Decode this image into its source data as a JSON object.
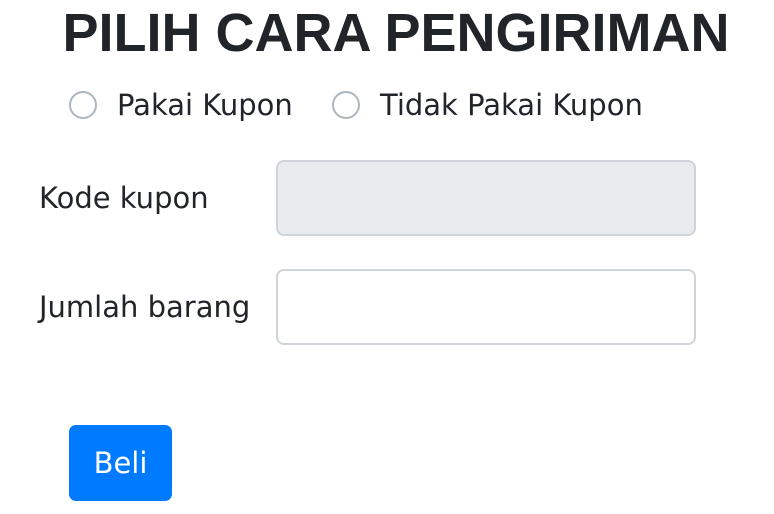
{
  "title": "PILIH CARA PENGIRIMAN",
  "options": [
    {
      "label": "Pakai Kupon",
      "checked": false
    },
    {
      "label": "Tidak Pakai Kupon",
      "checked": false
    }
  ],
  "fields": {
    "coupon_label": "Kode kupon",
    "coupon_value": "",
    "quantity_label": "Jumlah barang",
    "quantity_value": ""
  },
  "buy_label": "Beli",
  "colors": {
    "primary": "#007bff"
  }
}
